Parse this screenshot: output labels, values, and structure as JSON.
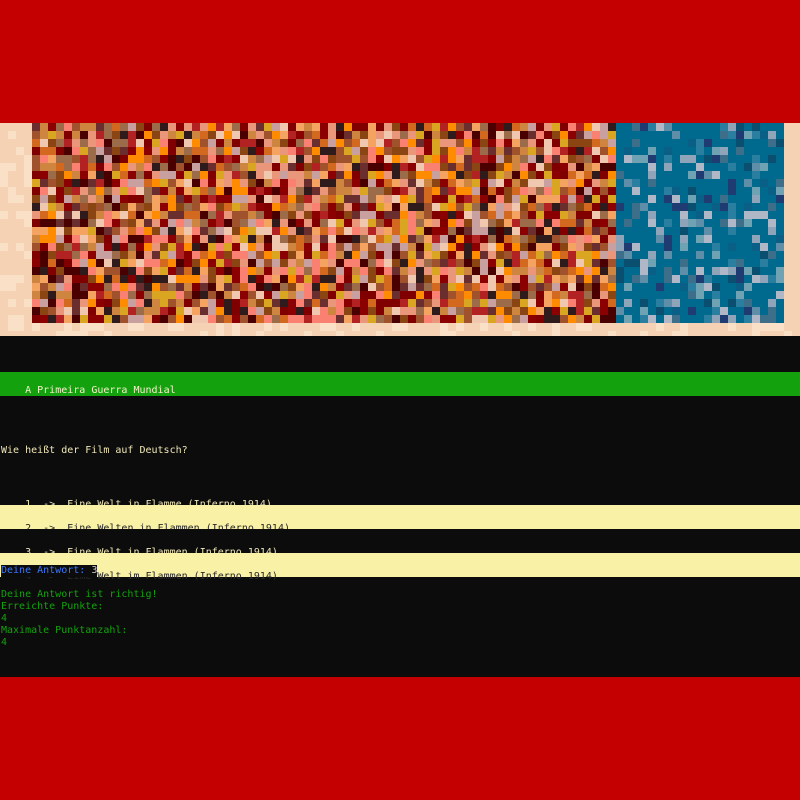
{
  "film_title": "A Primeira Guerra Mundial",
  "question": "Wie heißt der Film auf Deutsch?",
  "options": [
    {
      "text": "1  ->  Eine Welt in Flamme (Inferno 1914)"
    },
    {
      "text": "2  ->  Eine Welten in Flammen (Inferno 1914)"
    },
    {
      "text": "3  ->  Eine Welt in Flammen (Inferno 1914)"
    },
    {
      "text": "4  ->  Eime Welt im Flammen (Inferno 1914)"
    }
  ],
  "answer": {
    "label": "Deine Antwort: ",
    "value": "3"
  },
  "result": {
    "message": "Deine Antwort ist richtig!",
    "points_label": "Erreichte Punkte:",
    "points_value": "4",
    "max_label": "Maximale Punktanzahl:",
    "max_value": "4"
  },
  "colors": {
    "frame": "#c40000",
    "console_bg": "#0c0c0c",
    "title_bar": "#13a10e",
    "highlight_row": "#f9f1a5",
    "prompt_blue": "#3b78ff",
    "result_green": "#13a10e"
  }
}
